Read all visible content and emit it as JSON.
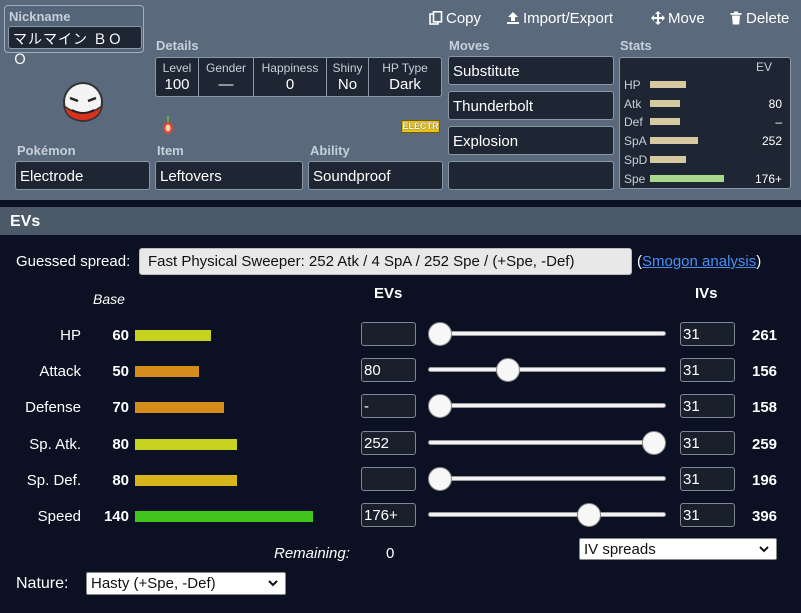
{
  "nickname": {
    "label": "Nickname",
    "value": "マルマイン ＢＯＯ"
  },
  "toolbar": {
    "copy": "Copy",
    "import_export": "Import/Export",
    "move": "Move",
    "delete": "Delete"
  },
  "details": {
    "label": "Details",
    "cells": [
      {
        "head": "Level",
        "value": "100"
      },
      {
        "head": "Gender",
        "value": "—"
      },
      {
        "head": "Happiness",
        "value": "0"
      },
      {
        "head": "Shiny",
        "value": "No"
      },
      {
        "head": "HP Type",
        "value": "Dark"
      }
    ]
  },
  "type_badge": "ELECTR",
  "pokemon": {
    "label": "Pokémon",
    "value": "Electrode"
  },
  "item": {
    "label": "Item",
    "value": "Leftovers"
  },
  "ability": {
    "label": "Ability",
    "value": "Soundproof"
  },
  "moves": {
    "label": "Moves",
    "list": [
      "Substitute",
      "Thunderbolt",
      "Explosion",
      ""
    ]
  },
  "stats": {
    "label": "Stats",
    "ev_head": "EV",
    "rows": [
      {
        "name": "HP",
        "ev": ""
      },
      {
        "name": "Atk",
        "ev": "80"
      },
      {
        "name": "Def",
        "ev": "–"
      },
      {
        "name": "SpA",
        "ev": "252"
      },
      {
        "name": "SpD",
        "ev": ""
      },
      {
        "name": "Spe",
        "ev": "176+"
      }
    ]
  },
  "evs_panel": {
    "title": "EVs",
    "guessed_label": "Guessed spread:",
    "guessed_value": "Fast Physical Sweeper: 252 Atk / 4 SpA / 252 Spe / (+Spe, -Def)",
    "smogon_open": "(",
    "smogon_link": "Smogon analysis",
    "smogon_close": ")",
    "base_head": "Base",
    "evs_head": "EVs",
    "ivs_head": "IVs",
    "rows": [
      {
        "name": "HP",
        "base": "60",
        "ev": "",
        "iv": "31",
        "total": "261",
        "bar_color": "#c7d21f",
        "ev_level": 0
      },
      {
        "name": "Attack",
        "base": "50",
        "ev": "80",
        "iv": "31",
        "total": "156",
        "bar_color": "#d68c1a",
        "ev_level": 80
      },
      {
        "name": "Defense",
        "base": "70",
        "ev": "-",
        "iv": "31",
        "total": "158",
        "bar_color": "#d68c1a",
        "ev_level": 0
      },
      {
        "name": "Sp. Atk.",
        "base": "80",
        "ev": "252",
        "iv": "31",
        "total": "259",
        "bar_color": "#c7d21f",
        "ev_level": 252
      },
      {
        "name": "Sp. Def.",
        "base": "80",
        "ev": "",
        "iv": "31",
        "total": "196",
        "bar_color": "#d8b41c",
        "ev_level": 0
      },
      {
        "name": "Speed",
        "base": "140",
        "ev": "176+",
        "iv": "31",
        "total": "396",
        "bar_color": "#3fc51c",
        "ev_level": 176
      }
    ],
    "remaining_label": "Remaining:",
    "remaining_value": "0",
    "iv_spreads": "IV spreads",
    "nature_label": "Nature:",
    "nature_value": "Hasty (+Spe, -Def)"
  }
}
